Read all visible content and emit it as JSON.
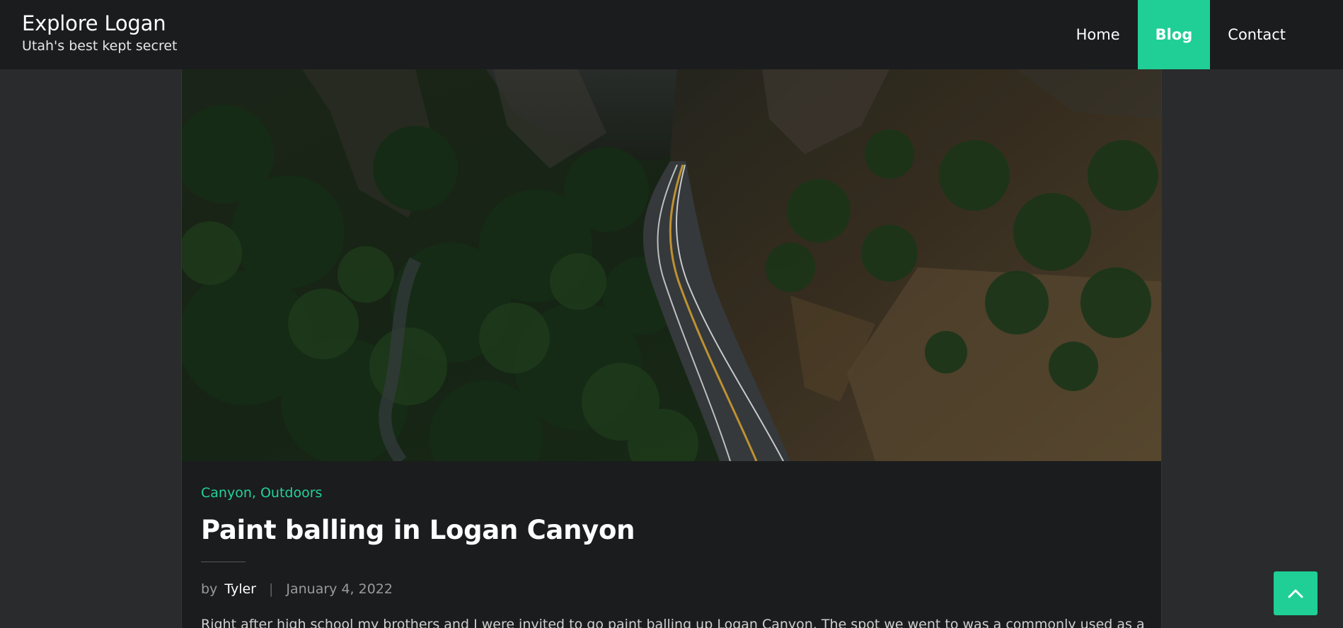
{
  "header": {
    "title": "Explore Logan",
    "tagline": "Utah's best kept secret"
  },
  "nav": {
    "items": [
      {
        "label": "Home"
      },
      {
        "label": "Blog"
      },
      {
        "label": "Contact"
      }
    ],
    "active": "Blog"
  },
  "post": {
    "categories": [
      "Canyon",
      "Outdoors"
    ],
    "category_separator": ", ",
    "title": "Paint balling in Logan Canyon",
    "by_label": "by",
    "author": "Tyler",
    "meta_separator": "|",
    "date": "January 4, 2022",
    "excerpt": "Right after high school my brothers and I were invited to go paint balling up Logan Canyon. The spot we went to was a commonly used as a"
  },
  "hero_image": {
    "subject": "aerial view of a winding road through a forested canyon"
  },
  "colors": {
    "accent": "#1fcf95",
    "header_bg": "#1b1c1e",
    "page_bg": "#2a2b2c"
  },
  "icons": {
    "back_to_top": "chevron-up-icon"
  }
}
